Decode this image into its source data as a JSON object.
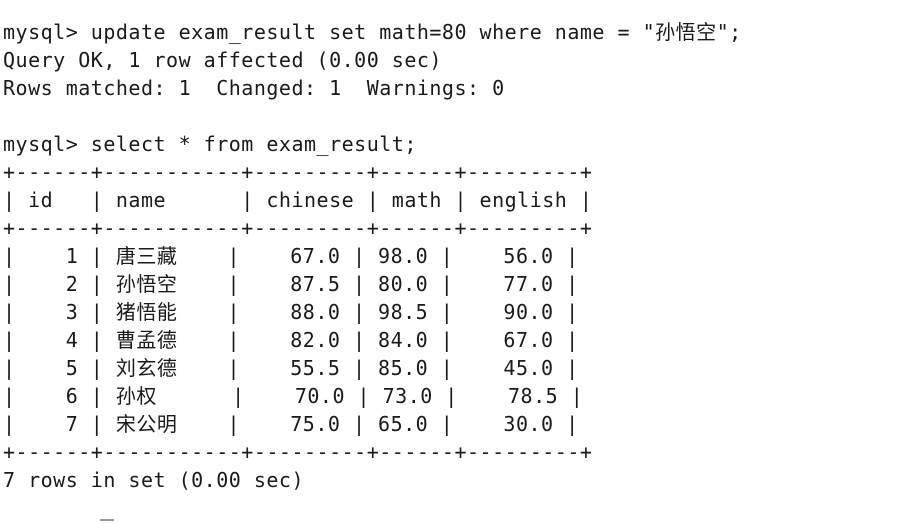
{
  "terminal": {
    "lines": [
      "mysql> update exam_result set math=80 where name = \"孙悟空\";",
      "Query OK, 1 row affected (0.00 sec)",
      "Rows matched: 1  Changed: 1  Warnings: 0",
      "",
      "mysql> select * from exam_result;",
      "+------+-----------+---------+------+---------+",
      "| id   | name      | chinese | math | english |",
      "+------+-----------+---------+------+---------+",
      "|    1 | 唐三藏    |    67.0 | 98.0 |    56.0 |",
      "|    2 | 孙悟空    |    87.5 | 80.0 |    77.0 |",
      "|    3 | 猪悟能    |    88.0 | 98.5 |    90.0 |",
      "|    4 | 曹孟德    |    82.0 | 84.0 |    67.0 |",
      "|    5 | 刘玄德    |    55.5 | 85.0 |    45.0 |",
      "|    6 | 孙权      |    70.0 | 73.0 |    78.5 |",
      "|    7 | 宋公明    |    75.0 | 65.0 |    30.0 |",
      "+------+-----------+---------+------+---------+",
      "7 rows in set (0.00 sec)"
    ]
  }
}
